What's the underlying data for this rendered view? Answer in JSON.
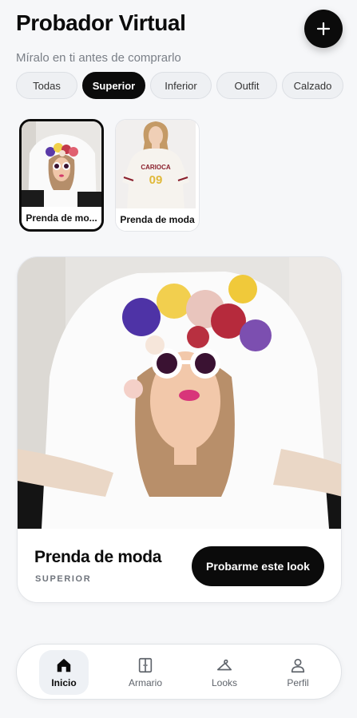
{
  "header": {
    "title": "Probador Virtual",
    "subtitle": "Míralo en ti antes de comprarlo",
    "add_icon": "plus-icon"
  },
  "categories": {
    "items": [
      "Todas",
      "Superior",
      "Inferior",
      "Outfit",
      "Calzado"
    ],
    "selected": "Superior"
  },
  "garments": [
    {
      "label": "Prenda de mo...",
      "selected": true,
      "image": "floral-girl-tshirt"
    },
    {
      "label": "Prenda de moda",
      "selected": false,
      "image": "carioca-09-tshirt",
      "print_text": "CARIOCA",
      "print_number": "09"
    }
  ],
  "preview": {
    "title": "Prenda de moda",
    "category": "SUPERIOR",
    "cta_label": "Probarme este look"
  },
  "bottom_nav": {
    "items": [
      {
        "label": "Inicio",
        "icon": "home-icon",
        "active": true
      },
      {
        "label": "Armario",
        "icon": "wardrobe-icon",
        "active": false
      },
      {
        "label": "Looks",
        "icon": "hanger-icon",
        "active": false
      },
      {
        "label": "Perfil",
        "icon": "user-icon",
        "active": false
      }
    ]
  },
  "colors": {
    "accent": "#0b0b0b",
    "background": "#f6f7f9",
    "muted_text": "#7a7f87"
  }
}
